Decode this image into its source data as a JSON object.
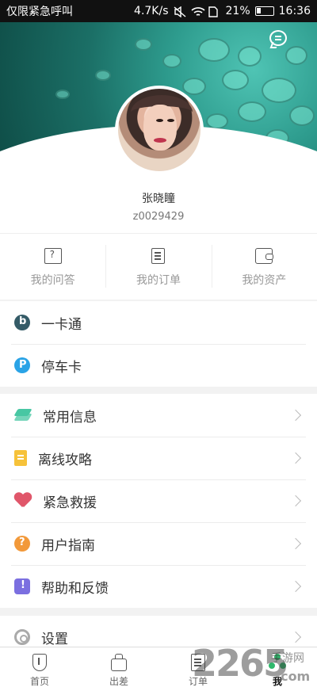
{
  "status_bar": {
    "carrier": "仅限紧急呼叫",
    "speed": "4.7K/s",
    "battery": "21%",
    "time": "16:36"
  },
  "profile": {
    "name": "张晓瞳",
    "id": "z0029429"
  },
  "quick_links": [
    {
      "label": "我的问答",
      "icon": "question-chat-icon"
    },
    {
      "label": "我的订单",
      "icon": "order-list-icon"
    },
    {
      "label": "我的资产",
      "icon": "wallet-icon"
    }
  ],
  "cards": [
    {
      "label": "一卡通",
      "icon": "transit-card-icon",
      "color": "#345b67"
    },
    {
      "label": "停车卡",
      "icon": "parking-icon",
      "color": "#2aa3e6"
    }
  ],
  "menu": [
    {
      "label": "常用信息",
      "icon": "layers-icon",
      "color": "#48c7a3"
    },
    {
      "label": "离线攻略",
      "icon": "notebook-icon",
      "color": "#f6c23a"
    },
    {
      "label": "紧急救援",
      "icon": "heart-pulse-icon",
      "color": "#e0566a"
    },
    {
      "label": "用户指南",
      "icon": "help-circle-icon",
      "color": "#f2993a"
    },
    {
      "label": "帮助和反馈",
      "icon": "alert-badge-icon",
      "color": "#7b6fe0"
    }
  ],
  "settings": {
    "label": "设置",
    "icon": "gear-icon"
  },
  "tabbar": [
    {
      "label": "首页",
      "icon": "home-icon"
    },
    {
      "label": "出差",
      "icon": "briefcase-icon"
    },
    {
      "label": "订单",
      "icon": "order-icon"
    },
    {
      "label": "我",
      "icon": "me-icon",
      "active": true
    }
  ],
  "watermark": {
    "number": "2265",
    "site": "手游网",
    "domain": ".com"
  }
}
